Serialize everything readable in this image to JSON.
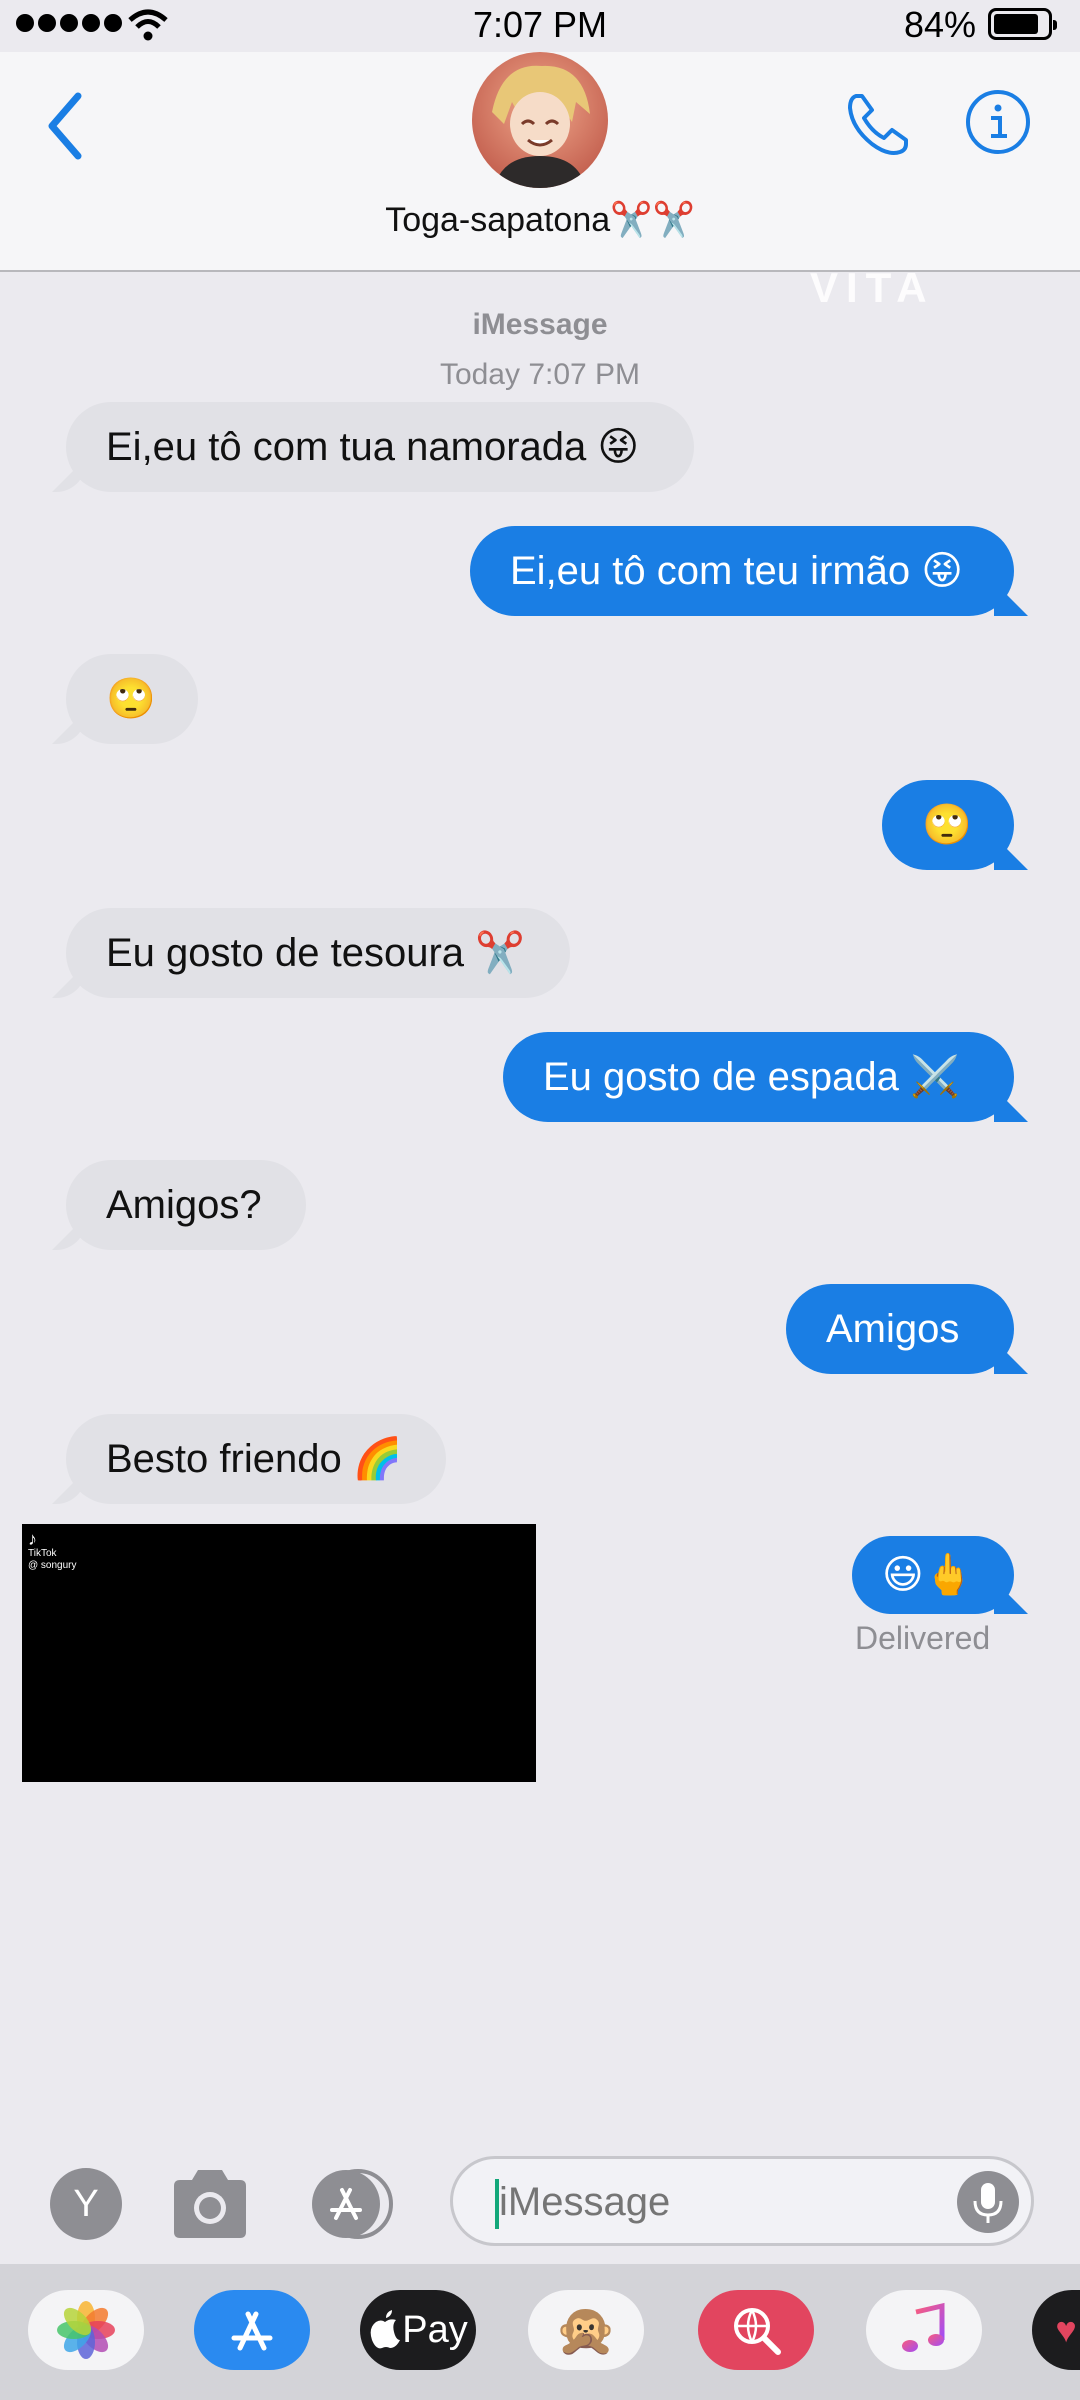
{
  "status_bar": {
    "time": "7:07 PM",
    "battery_percent": "84%",
    "battery_level": 0.84
  },
  "header": {
    "contact_name": "Toga-sapatona✂️✂️"
  },
  "watermark": "VITA",
  "conversation": {
    "service_label": "iMessage",
    "timestamp": "Today 7:07 PM"
  },
  "messages": [
    {
      "direction": "incoming",
      "text": "Ei,eu tô com tua namorada 😝"
    },
    {
      "direction": "outgoing",
      "text": "Ei,eu tô com teu irmão 😝"
    },
    {
      "direction": "incoming",
      "text": "🙄"
    },
    {
      "direction": "outgoing",
      "text": "🙄"
    },
    {
      "direction": "incoming",
      "text": "Eu gosto de tesoura ✂️"
    },
    {
      "direction": "outgoing",
      "text": "Eu gosto de espada ⚔️"
    },
    {
      "direction": "incoming",
      "text": "Amigos?"
    },
    {
      "direction": "outgoing",
      "text": "Amigos"
    },
    {
      "direction": "incoming",
      "text": "Besto friendo 🌈"
    },
    {
      "direction": "outgoing",
      "text": "😃🖕"
    }
  ],
  "video_overlay": {
    "brand": "TikTok",
    "handle": "@ songury"
  },
  "delivery_status": "Delivered",
  "input_bar": {
    "y_app_label": "Y",
    "placeholder": "iMessage"
  },
  "app_drawer": [
    {
      "name": "Photos",
      "icon": "photos-icon"
    },
    {
      "name": "App Store",
      "icon": "appstore-icon"
    },
    {
      "name": "Apple Pay",
      "icon": "applepay-icon",
      "label": "Pay"
    },
    {
      "name": "Animoji",
      "icon": "monkey-icon"
    },
    {
      "name": "Web Search",
      "icon": "globe-search-icon"
    },
    {
      "name": "Music",
      "icon": "music-icon"
    }
  ],
  "colors": {
    "outgoing": "#1a7ee4",
    "incoming": "#e1e1e6",
    "background": "#ebeaef",
    "accent": "#1a7ee4"
  }
}
